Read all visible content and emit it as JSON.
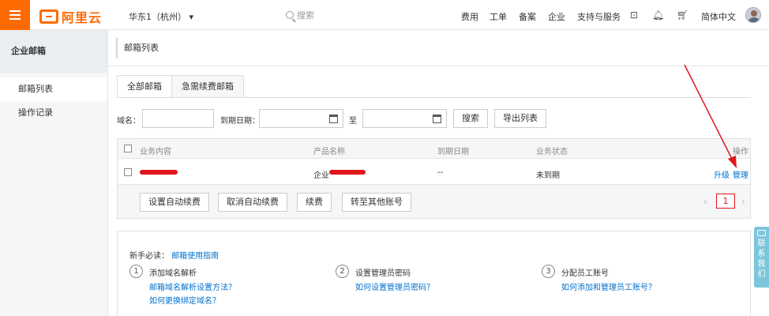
{
  "header": {
    "logo_text": "阿里云",
    "region": "华东1（杭州）",
    "search_placeholder": "搜索",
    "nav": [
      "费用",
      "工单",
      "备案",
      "企业",
      "支持与服务"
    ],
    "language": "简体中文"
  },
  "sidebar": {
    "title": "企业邮箱",
    "items": [
      {
        "label": "邮箱列表",
        "active": true
      },
      {
        "label": "操作记录",
        "active": false
      }
    ]
  },
  "main": {
    "title": "邮箱列表",
    "tabs": [
      {
        "label": "全部邮箱",
        "active": true
      },
      {
        "label": "急需续费邮箱",
        "active": false
      }
    ],
    "filter": {
      "domain_label": "域名：",
      "date_label": "到期日期：",
      "to_label": "至",
      "search_button": "搜索",
      "export_button": "导出列表"
    },
    "table": {
      "columns": [
        "业务内容",
        "产品名称",
        "到期日期",
        "业务状态",
        "操作"
      ],
      "rows": [
        {
          "content": "",
          "product": "企业",
          "expiry": "--",
          "status": "未到期",
          "actions": [
            "升级",
            "管理"
          ]
        }
      ],
      "bulk_actions": [
        "设置自动续费",
        "取消自动续费",
        "续费",
        "转至其他账号"
      ],
      "page": "1"
    },
    "guide": {
      "title_prefix": "新手必读：",
      "title_link": "邮箱使用指南",
      "steps": [
        {
          "num": "1",
          "title": "添加域名解析",
          "links": [
            "邮箱域名解析设置方法？",
            "如何更换绑定域名？"
          ]
        },
        {
          "num": "2",
          "title": "设置管理员密码",
          "links": [
            "如何设置管理员密码？"
          ]
        },
        {
          "num": "3",
          "title": "分配员工账号",
          "links": [
            "如何添加和管理员工账号？"
          ]
        }
      ]
    }
  },
  "contact": {
    "label": [
      "联",
      "系",
      "我",
      "们"
    ]
  },
  "colors": {
    "brand": "#ff6a00",
    "link": "#0070cc",
    "annotation": "#e0161b"
  }
}
